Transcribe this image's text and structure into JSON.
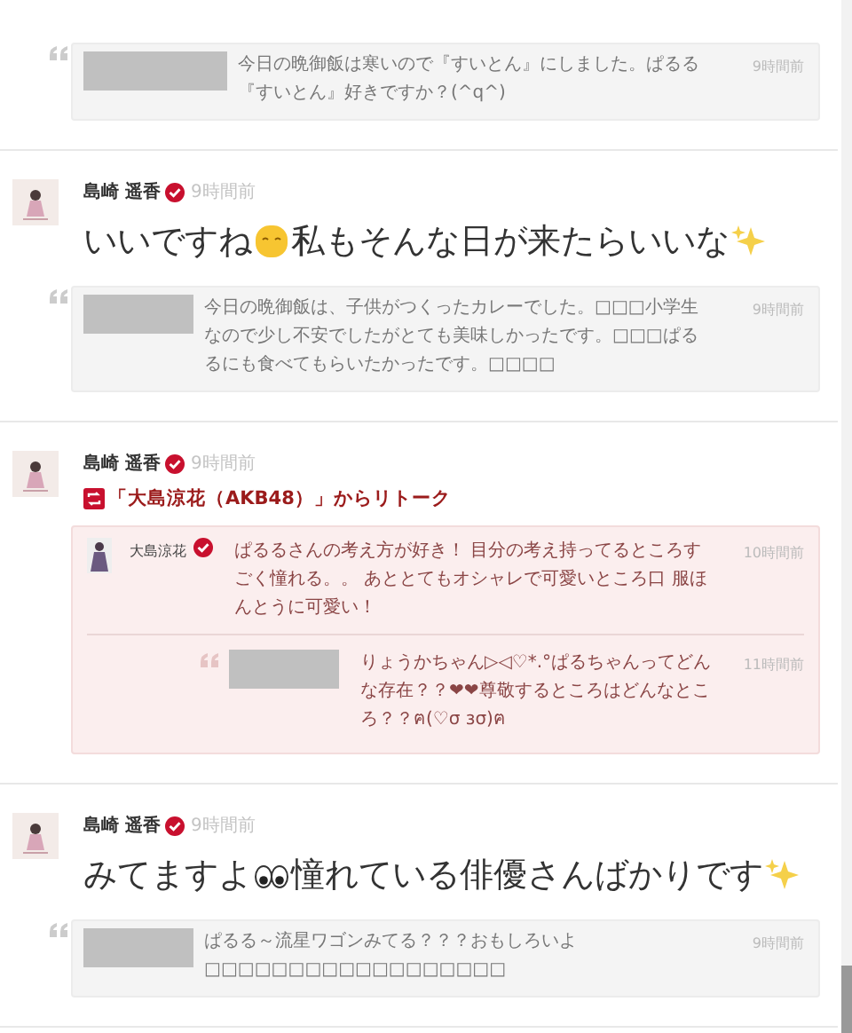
{
  "feed": [
    {
      "kind": "quote_only",
      "quote": {
        "text": "今日の晩御飯は寒いので『すいとん』にしました。ぱるる『すいとん』好きですか？(^q^)",
        "time": "9時間前"
      }
    },
    {
      "kind": "post",
      "author": "島崎 遥香",
      "time": "9時間前",
      "segments": [
        {
          "kind": "text",
          "text": "いいですね"
        },
        {
          "kind": "smiley"
        },
        {
          "kind": "text",
          "text": "私もそんな日が来たらいいな"
        },
        {
          "kind": "sparkles"
        }
      ],
      "quote": {
        "text": "今日の晩御飯は、子供がつくったカレーでした。□□□小学生なので少し不安でしたがとても美味しかったです。□□□ぱるるにも食べてもらいたかったです。□□□□",
        "time": "9時間前"
      }
    },
    {
      "kind": "retalk",
      "author": "島崎 遥香",
      "time": "9時間前",
      "retalk_label": "「大島涼花（AKB48）」からリトーク",
      "inner": {
        "author": "大島涼花",
        "text": "ぱるるさんの考え方が好き！ 目分の考え持ってるところすごく憧れる。。 あととてもオシャレで可愛いところ口 服ほんとうに可愛い！",
        "time": "10時間前",
        "quote": {
          "text": "りょうかちゃん▷◁♡*.°ぱるちゃんってどんな存在？？❤❤尊敬するところはどんなところ？？ฅ(♡σ ɜσ)ฅ",
          "time": "11時間前"
        }
      }
    },
    {
      "kind": "post",
      "author": "島崎 遥香",
      "time": "9時間前",
      "segments": [
        {
          "kind": "text",
          "text": "みてますよ"
        },
        {
          "kind": "eyes"
        },
        {
          "kind": "text",
          "text": "憧れている俳優さんばかりです"
        },
        {
          "kind": "sparkles"
        }
      ],
      "quote": {
        "text": "ぱるる～流星ワゴンみてる？？？おもしろいよ□□□□□□□□□□□□□□□□□□",
        "time": "9時間前"
      }
    }
  ]
}
